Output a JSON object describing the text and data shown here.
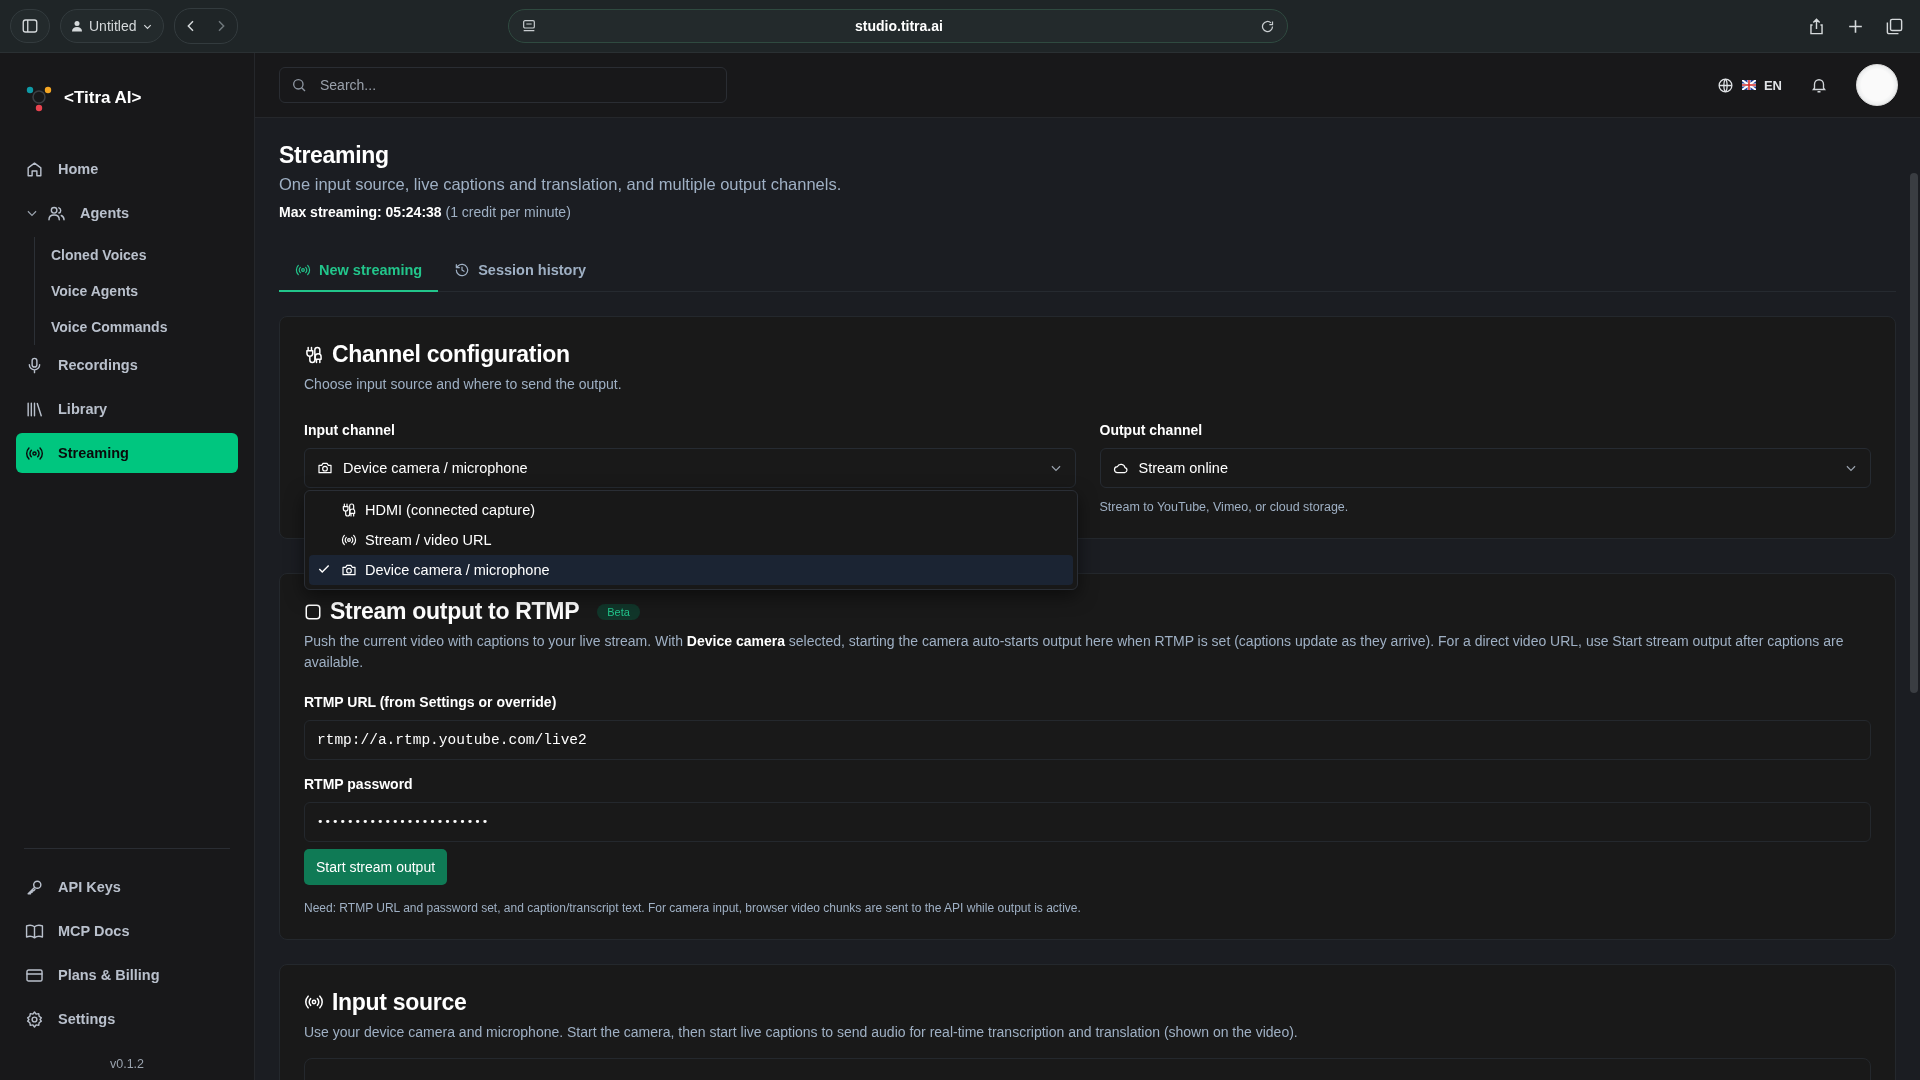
{
  "browser": {
    "profile": "Untitled",
    "address": "studio.titra.ai"
  },
  "sidebar": {
    "brand": "<Titra AI>",
    "items": [
      {
        "label": "Home",
        "kind": "home",
        "selected": false
      },
      {
        "label": "Agents",
        "kind": "users",
        "selected": false,
        "expanded": true,
        "children": [
          {
            "label": "Cloned Voices"
          },
          {
            "label": "Voice Agents"
          },
          {
            "label": "Voice Commands"
          }
        ]
      },
      {
        "label": "Recordings",
        "kind": "mic",
        "selected": false
      },
      {
        "label": "Library",
        "kind": "library",
        "selected": false
      },
      {
        "label": "Streaming",
        "kind": "broadcast",
        "selected": true
      }
    ],
    "bottom_items": [
      {
        "label": "API Keys",
        "kind": "key",
        "selected": false
      },
      {
        "label": "MCP Docs",
        "kind": "book",
        "selected": false
      },
      {
        "label": "Plans & Billing",
        "kind": "card",
        "selected": false
      },
      {
        "label": "Settings",
        "kind": "gear",
        "selected": false
      }
    ],
    "version": "v0.1.2"
  },
  "header": {
    "search_placeholder": "Search...",
    "language": "EN"
  },
  "page": {
    "title": "Streaming",
    "subtitle": "One input source, live captions and translation, and multiple output channels.",
    "max_label": "Max streaming: 05:24:38",
    "max_note": "(1 credit per minute)"
  },
  "tabs": [
    {
      "label": "New streaming",
      "kind": "broadcast",
      "selected": true
    },
    {
      "label": "Session history",
      "kind": "history",
      "selected": false
    }
  ],
  "channel_config": {
    "title": "Channel configuration",
    "description": "Choose input source and where to send the output.",
    "input": {
      "label": "Input channel",
      "value": "Device camera / microphone",
      "kind": "camera",
      "expanded": true,
      "options": [
        {
          "label": "HDMI (connected capture)",
          "kind": "cable",
          "selected": false
        },
        {
          "label": "Stream / video URL",
          "kind": "broadcast",
          "selected": false
        },
        {
          "label": "Device camera / microphone",
          "kind": "camera",
          "selected": true
        }
      ]
    },
    "output": {
      "label": "Output channel",
      "value": "Stream online",
      "kind": "cloud",
      "hint": "Stream to YouTube, Vimeo, or cloud storage."
    }
  },
  "rtmp": {
    "title": "Stream output to RTMP",
    "badge": "Beta",
    "description": "Push the current video with captions to your live stream. With **Device camera** selected, starting the camera auto-starts output here when RTMP is set (captions update as they arrive). For a direct video URL, use Start stream output after captions are available.",
    "url_label": "RTMP URL (from Settings or override)",
    "url_value": "rtmp://a.rtmp.youtube.com/live2",
    "password_label": "RTMP password",
    "password_value": "•••••••••••••••••••••••",
    "button": "Start stream output",
    "note": "Need: RTMP URL and password set, and caption/transcript text. For camera input, browser video chunks are sent to the API while output is active."
  },
  "input_source": {
    "title": "Input source",
    "description": "Use your device camera and microphone. Start the camera, then start live captions to send audio for real-time transcription and translation (shown on the video)."
  }
}
